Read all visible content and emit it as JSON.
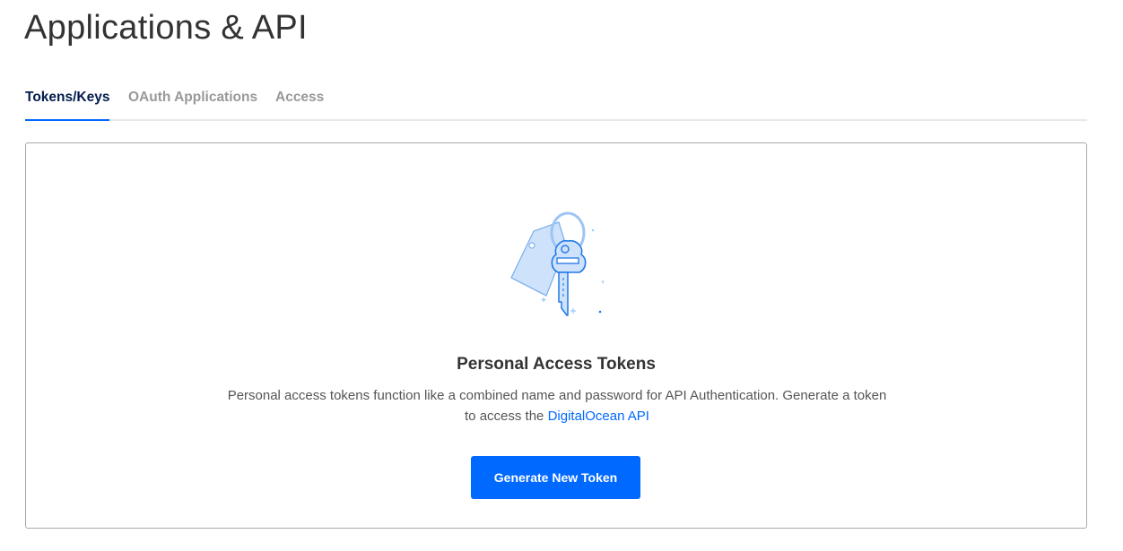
{
  "page": {
    "title": "Applications & API"
  },
  "tabs": [
    {
      "label": "Tokens/Keys",
      "active": true
    },
    {
      "label": "OAuth Applications",
      "active": false
    },
    {
      "label": "Access",
      "active": false
    }
  ],
  "empty_state": {
    "icon": "key-ring-icon",
    "title": "Personal Access Tokens",
    "description_before_link": "Personal access tokens function like a combined name and password for API Authentication. Generate a token to access the ",
    "link_text": "DigitalOcean API",
    "button_label": "Generate New Token"
  },
  "colors": {
    "accent": "#0069ff",
    "active_tab_text": "#031b4e",
    "inactive_tab_text": "#999999",
    "tab_underline": "#e5e8ed",
    "card_border": "#a9a9a9"
  }
}
